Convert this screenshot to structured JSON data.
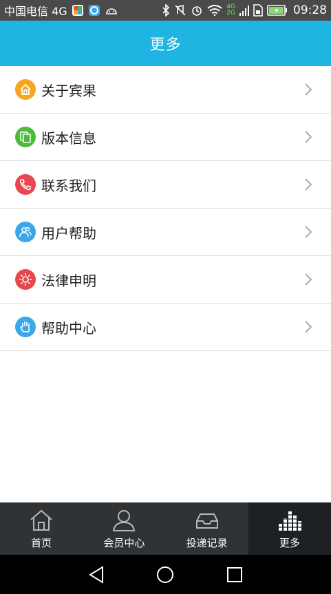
{
  "status_bar": {
    "carrier": "中国电信 4G",
    "network_4g": "4G",
    "network_2g": "2G",
    "time": "09:28",
    "icons": [
      "app-icon-colorful",
      "app-icon-blue",
      "android-icon",
      "bluetooth-icon",
      "mute-icon",
      "alarm-icon",
      "wifi-icon",
      "signal-icon",
      "sim-icon",
      "battery-charging-icon"
    ]
  },
  "header": {
    "title": "更多"
  },
  "menu": {
    "items": [
      {
        "label": "关于宾果",
        "icon": "home-icon",
        "color": "#f5a623"
      },
      {
        "label": "版本信息",
        "icon": "copy-icon",
        "color": "#4cbb3a"
      },
      {
        "label": "联系我们",
        "icon": "phone-icon",
        "color": "#e5484d"
      },
      {
        "label": "用户帮助",
        "icon": "users-icon",
        "color": "#3aa7e8"
      },
      {
        "label": "法律申明",
        "icon": "sun-icon",
        "color": "#e5484d"
      },
      {
        "label": "帮助中心",
        "icon": "hand-icon",
        "color": "#3aa7e8"
      }
    ]
  },
  "tabs": [
    {
      "label": "首页",
      "icon": "home-outline-icon",
      "active": false
    },
    {
      "label": "会员中心",
      "icon": "person-outline-icon",
      "active": false
    },
    {
      "label": "投递记录",
      "icon": "inbox-outline-icon",
      "active": false
    },
    {
      "label": "更多",
      "icon": "equalizer-icon",
      "active": true
    }
  ],
  "colors": {
    "accent": "#1fb4e2",
    "tab_bg": "#2f3336",
    "tab_active_bg": "#1e2124"
  }
}
